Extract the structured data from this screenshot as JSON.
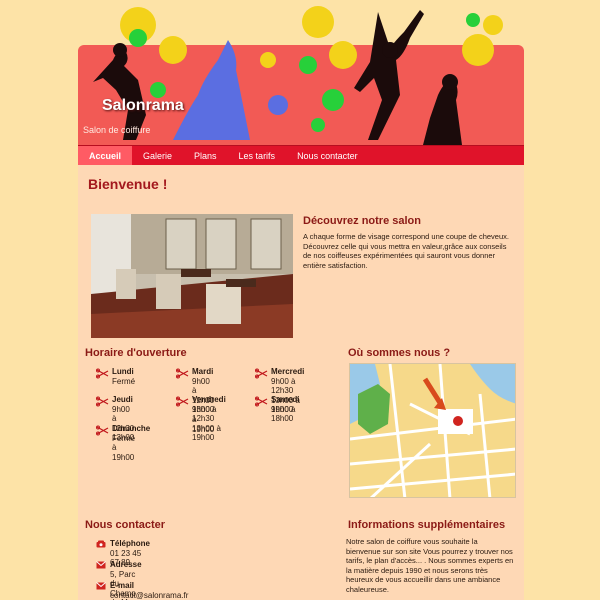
{
  "site": {
    "title": "Salonrama",
    "subtitle": "Salon de coiffure"
  },
  "nav": {
    "items": [
      {
        "label": "Accueil",
        "active": true
      },
      {
        "label": "Galerie",
        "active": false
      },
      {
        "label": "Plans",
        "active": false
      },
      {
        "label": "Les tarifs",
        "active": false
      },
      {
        "label": "Nous contacter",
        "active": false
      }
    ]
  },
  "main": {
    "title": "Bienvenue !",
    "discover": {
      "heading": "Découvrez notre salon",
      "text": "A chaque forme de visage correspond une coupe de cheveux. Découvrez celle qui vous mettra en valeur,grâce aux conseils de nos coiffeuses expérimentées qui sauront vous donner entière satisfaction."
    },
    "hours": {
      "heading": "Horaire d'ouverture",
      "days": [
        {
          "name": "Lundi",
          "lines": [
            "Fermé"
          ]
        },
        {
          "name": "Mardi",
          "lines": [
            "9h00 à 12h30",
            "13h00 à 19h00"
          ]
        },
        {
          "name": "Mercredi",
          "lines": [
            "9h00 à 12h30",
            "13h00 à 19h00"
          ]
        },
        {
          "name": "Jeudi",
          "lines": [
            "9h00 à 12h30",
            "13h00 à 19h00"
          ]
        },
        {
          "name": "Vendredi",
          "lines": [
            "9h00 à 12h30",
            "13h00 à 19h00"
          ]
        },
        {
          "name": "Samedi",
          "lines": [
            "9h00 à 18h00"
          ]
        },
        {
          "name": "Dimanche",
          "lines": [
            "Fermé"
          ]
        }
      ]
    },
    "location": {
      "heading": "Où sommes nous ?"
    },
    "contact": {
      "heading": "Nous contacter",
      "items": [
        {
          "label": "Téléphone",
          "value": "01 23 45 67 89",
          "icon": "phone-icon"
        },
        {
          "label": "Adresse",
          "value": "5, Parc du Champ de Mars",
          "icon": "envelope-icon"
        },
        {
          "label": "E-mail",
          "value": "contact@salonrama.fr",
          "icon": "envelope-icon"
        }
      ]
    },
    "info": {
      "heading": "Informations supplémentaires",
      "text": "Notre salon de coiffure vous souhaite la bienvenue sur son site Vous pourrez y trouver nos tarifs, le plan d'accès... . Nous sommes experts en la matière depuis 1990 et nous serons très heureux de vous accueillir dans une ambiance chaleureuse."
    }
  },
  "colors": {
    "nav": "#e0132a",
    "header": "#f25a55",
    "content_bg": "#fed8b5",
    "heading": "#8b1a16",
    "page_bg": "#fde3a7"
  }
}
